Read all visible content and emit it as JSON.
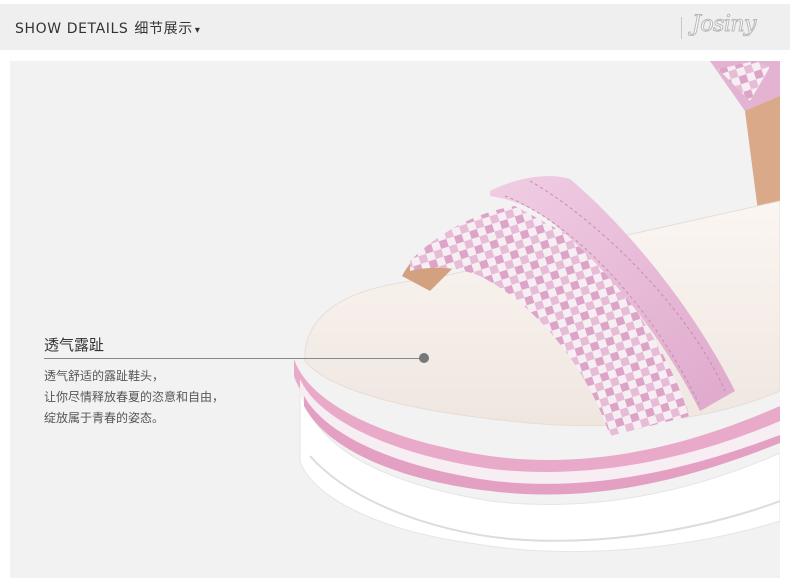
{
  "header": {
    "title_en": "SHOW DETAILS",
    "title_cn": "细节展示",
    "caret": "▾",
    "brand": "Josiny"
  },
  "callout": {
    "title": "透气露趾",
    "lines": [
      "透气舒适的露趾鞋头，",
      "让你尽情释放春夏的恣意和自由，",
      "绽放属于青春的姿态。"
    ]
  },
  "colors": {
    "header_bg": "#efefef",
    "photo_bg": "#f2f2f2",
    "strap_pink": "#e7b7d6",
    "check_pink": "#d99cc4",
    "sole_pink": "#e9a9c8",
    "footbed": "#f6f0ec"
  }
}
